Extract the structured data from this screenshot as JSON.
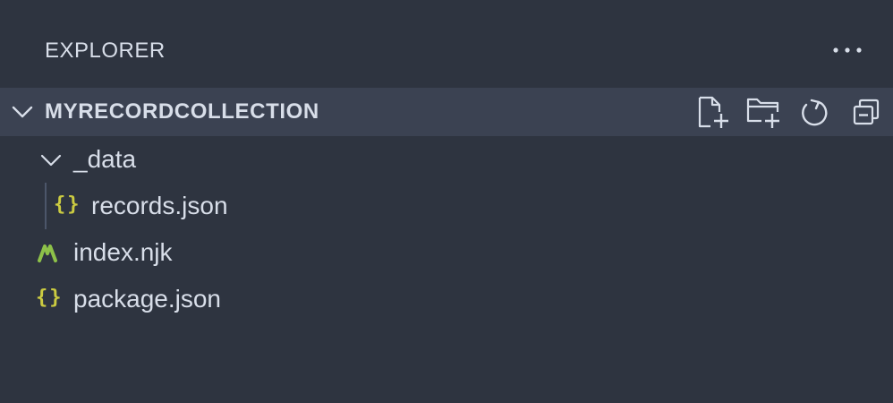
{
  "explorer": {
    "title": "EXPLORER",
    "more_icon": "ellipsis-icon"
  },
  "workspace": {
    "name": "MYRECORDCOLLECTION",
    "expanded": true,
    "actions": [
      {
        "icon": "new-file-icon"
      },
      {
        "icon": "new-folder-icon"
      },
      {
        "icon": "refresh-icon"
      },
      {
        "icon": "collapse-all-icon"
      }
    ]
  },
  "tree": {
    "folder_data": {
      "label": "_data",
      "expanded": true,
      "icon": "chevron-down-icon"
    },
    "records_json": {
      "label": "records.json",
      "icon": "json-icon"
    },
    "index_njk": {
      "label": "index.njk",
      "icon": "nunjucks-icon"
    },
    "package_json": {
      "label": "package.json",
      "icon": "json-icon"
    }
  },
  "colors": {
    "background": "#2e3440",
    "section_header": "#3b4252",
    "text": "#d8dee9",
    "json_icon": "#cbcb41",
    "nunjucks_icon": "#8dc149",
    "indent_guide": "#4c566a"
  }
}
